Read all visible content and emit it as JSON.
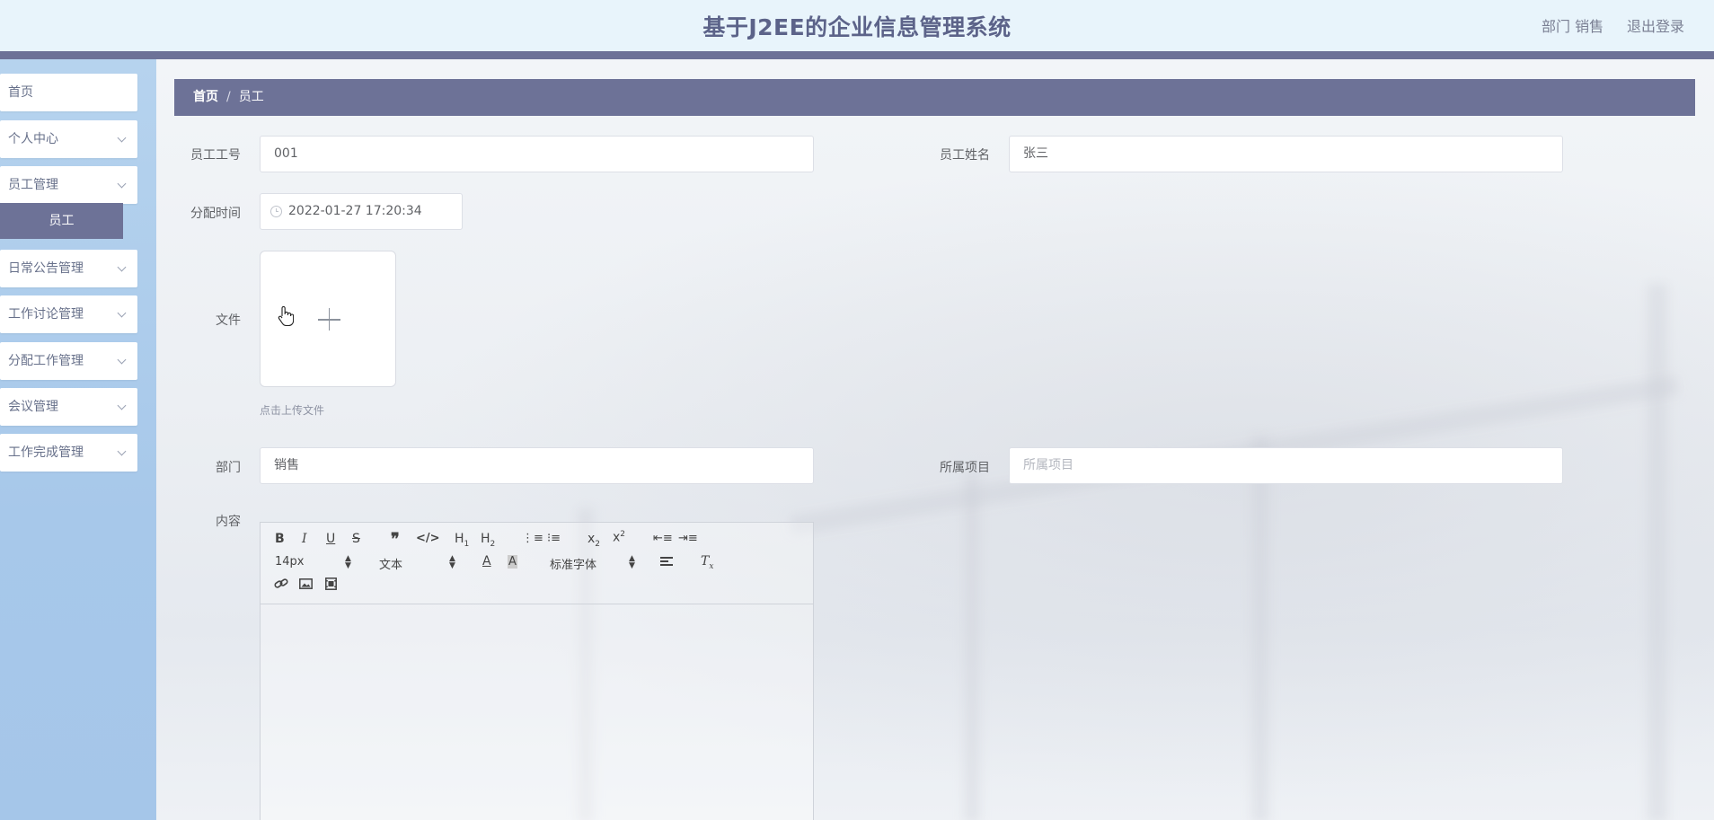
{
  "header": {
    "title": "基于J2EE的企业信息管理系统",
    "dept": "部门 销售",
    "logout": "退出登录"
  },
  "sidebar": {
    "items": [
      {
        "label": "首页",
        "has_arrow": false
      },
      {
        "label": "个人中心",
        "has_arrow": true
      },
      {
        "label": "员工管理",
        "has_arrow": true
      },
      {
        "label": "日常公告管理",
        "has_arrow": true
      },
      {
        "label": "工作讨论管理",
        "has_arrow": true
      },
      {
        "label": "分配工作管理",
        "has_arrow": true
      },
      {
        "label": "会议管理",
        "has_arrow": true
      },
      {
        "label": "工作完成管理",
        "has_arrow": true
      }
    ],
    "sub_item": "员工"
  },
  "breadcrumb": {
    "home": "首页",
    "separator": "/",
    "current": "员工"
  },
  "form": {
    "emp_no_label": "员工工号",
    "emp_no_value": "001",
    "emp_name_label": "员工姓名",
    "emp_name_value": "张三",
    "assign_time_label": "分配时间",
    "assign_time_value": "2022-01-27 17:20:34",
    "file_label": "文件",
    "upload_tip": "点击上传文件",
    "dept_label": "部门",
    "dept_value": "销售",
    "project_label": "所属项目",
    "project_placeholder": "所属项目",
    "content_label": "内容"
  },
  "editor": {
    "font_size": "14px",
    "header_select": "文本",
    "font_family": "标准字体"
  },
  "colors": {
    "accent": "#6d7297",
    "header_bg": "#e8f4fb",
    "sidebar_bg": "#a9c9ea",
    "title": "#5c6389"
  }
}
